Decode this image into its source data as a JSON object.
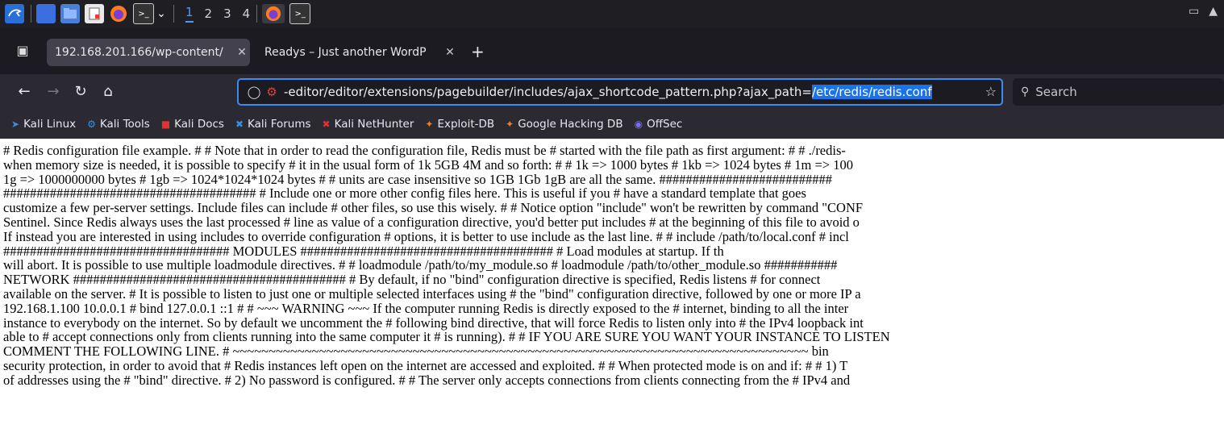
{
  "taskbar": {
    "workspaces": [
      "1",
      "2",
      "3",
      "4"
    ],
    "active_workspace": "1"
  },
  "tabs": [
    {
      "label": "192.168.201.166/wp-content/",
      "active": true
    },
    {
      "label": "Readys – Just another WordP",
      "active": false
    }
  ],
  "nav": {
    "url_prefix": "-editor/editor/extensions/pagebuilder/includes/ajax_shortcode_pattern.php?ajax_path=",
    "url_selected": "/etc/redis/redis.conf",
    "search_placeholder": "Search"
  },
  "bookmarks": [
    {
      "label": "Kali Linux",
      "icon": "kali-icon",
      "color": "#3a8ee6"
    },
    {
      "label": "Kali Tools",
      "icon": "kali-tools-icon",
      "color": "#3a8ee6"
    },
    {
      "label": "Kali Docs",
      "icon": "kali-docs-icon",
      "color": "#d33"
    },
    {
      "label": "Kali Forums",
      "icon": "kali-forums-icon",
      "color": "#3a8ee6"
    },
    {
      "label": "Kali NetHunter",
      "icon": "nethunter-icon",
      "color": "#d33"
    },
    {
      "label": "Exploit-DB",
      "icon": "exploit-db-icon",
      "color": "#e8802a"
    },
    {
      "label": "Google Hacking DB",
      "icon": "ghdb-icon",
      "color": "#e8802a"
    },
    {
      "label": "OffSec",
      "icon": "offsec-icon",
      "color": "#7b6cf0"
    }
  ],
  "page": {
    "lines": [
      "# Redis configuration file example. # # Note that in order to read the configuration file, Redis must be # started with the file path as first argument: # # ./redis-",
      "when memory size is needed, it is possible to specify # it in the usual form of 1k 5GB 4M and so forth: # # 1k => 1000 bytes # 1kb => 1024 bytes # 1m => 100",
      "1g => 1000000000 bytes # 1gb => 1024*1024*1024 bytes # # units are case insensitive so 1GB 1Gb 1gB are all the same. ##########################",
      "###################################### # Include one or more other config files here. This is useful if you # have a standard template that goes",
      "customize a few per-server settings. Include files can include # other files, so use this wisely. # # Notice option \"include\" won't be rewritten by command \"CONF",
      "Sentinel. Since Redis always uses the last processed # line as value of a configuration directive, you'd better put includes # at the beginning of this file to avoid o",
      "If instead you are interested in using includes to override configuration # options, it is better to use include as the last line. # # include /path/to/local.conf # incl",
      "################################## MODULES ###################################### # Load modules at startup. If th",
      "will abort. It is possible to use multiple loadmodule directives. # # loadmodule /path/to/my_module.so # loadmodule /path/to/other_module.so ###########",
      "NETWORK ######################################### # By default, if no \"bind\" configuration directive is specified, Redis listens # for connect",
      "available on the server. # It is possible to listen to just one or multiple selected interfaces using # the \"bind\" configuration directive, followed by one or more IP a",
      "192.168.1.100 10.0.0.1 # bind 127.0.0.1 ::1 # # ~~~ WARNING ~~~ If the computer running Redis is directly exposed to the # internet, binding to all the inter",
      "instance to everybody on the internet. So by default we uncomment the # following bind directive, that will force Redis to listen only into # the IPv4 loopback int",
      "able to # accept connections only from clients running into the same computer it # is running). # # IF YOU ARE SURE YOU WANT YOUR INSTANCE TO LISTEN",
      "COMMENT THE FOLLOWING LINE. # ~~~~~~~~~~~~~~~~~~~~~~~~~~~~~~~~~~~~~~~~~~~~~~~~~~~~~~~~~~~~~~~~~~~~~~~~~~~~~~~~ bin",
      "security protection, in order to avoid that # Redis instances left open on the internet are accessed and exploited. # # When protected mode is on and if: # # 1) T",
      "of addresses using the # \"bind\" directive. # 2) No password is configured. # # The server only accepts connections from clients connecting from the # IPv4 and"
    ]
  }
}
